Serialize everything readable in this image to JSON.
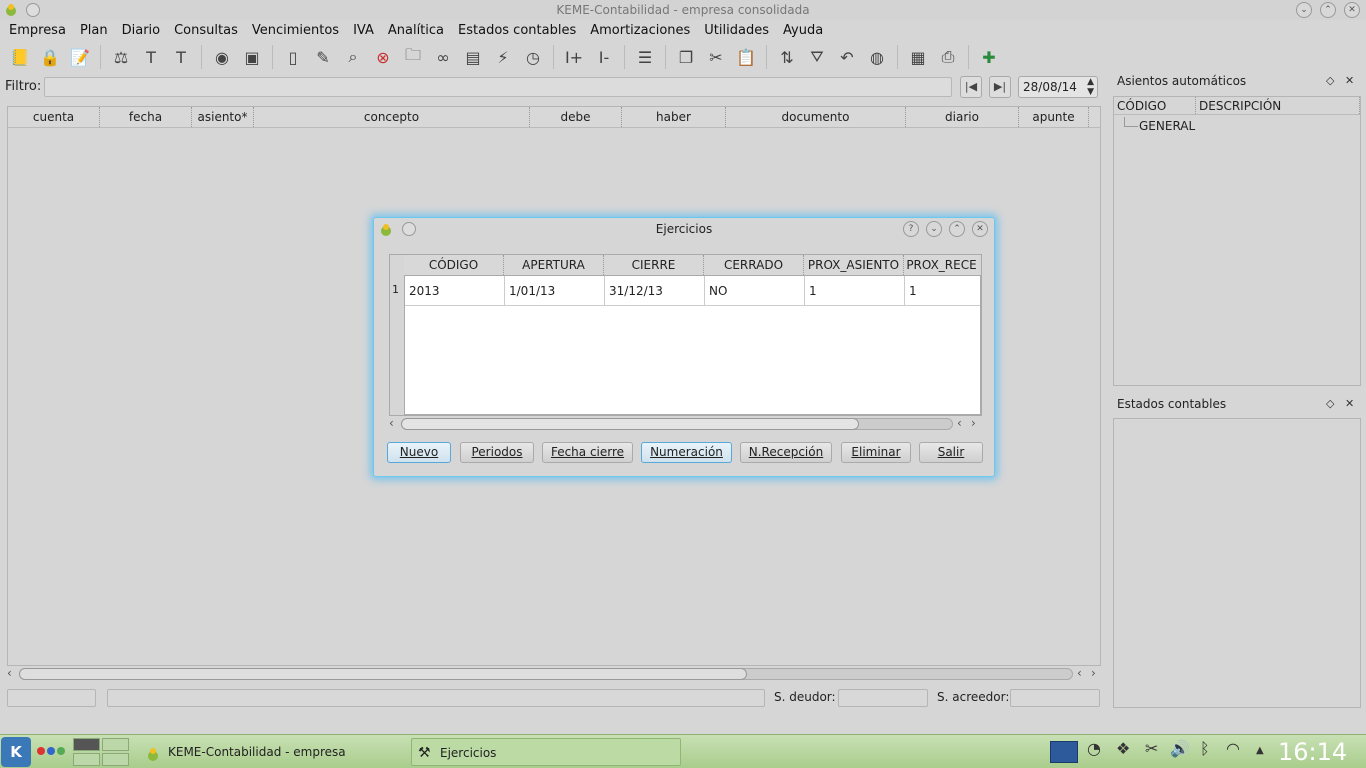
{
  "window": {
    "title": "KEME-Contabilidad - empresa consolidada"
  },
  "menu": [
    "Empresa",
    "Plan",
    "Diario",
    "Consultas",
    "Vencimientos",
    "IVA",
    "Analítica",
    "Estados contables",
    "Amortizaciones",
    "Utilidades",
    "Ayuda"
  ],
  "filter": {
    "label": "Filtro:",
    "value": "",
    "date": "28/08/14"
  },
  "main_table": {
    "columns": [
      "cuenta",
      "fecha",
      "asiento*",
      "concepto",
      "debe",
      "haber",
      "documento",
      "diario",
      "apunte"
    ]
  },
  "status": {
    "deudor_label": "S. deudor:",
    "acreedor_label": "S. acreedor:"
  },
  "dock_auto": {
    "title": "Asientos automáticos",
    "col_code": "CÓDIGO",
    "col_desc": "DESCRIPCIÓN",
    "item": "GENERAL"
  },
  "dock_estados": {
    "title": "Estados contables"
  },
  "dialog": {
    "title": "Ejercicios",
    "columns": [
      "CÓDIGO",
      "APERTURA",
      "CIERRE",
      "CERRADO",
      "PROX_ASIENTO",
      "PROX_RECE"
    ],
    "rows": [
      {
        "num": "1",
        "cells": [
          "2013",
          "1/01/13",
          "31/12/13",
          "NO",
          "1",
          "1"
        ]
      }
    ],
    "buttons": [
      "Nuevo",
      "Periodos",
      "Fecha cierre",
      "Numeración",
      "N.Recepción",
      "Eliminar",
      "Salir"
    ]
  },
  "taskbar": {
    "tasks": [
      "KEME-Contabilidad - empresa consolidada",
      "Ejercicios"
    ],
    "clock": "16:14"
  },
  "colors": {
    "accent": "#6cc8ec",
    "taskbar": "#a9cd8c"
  }
}
